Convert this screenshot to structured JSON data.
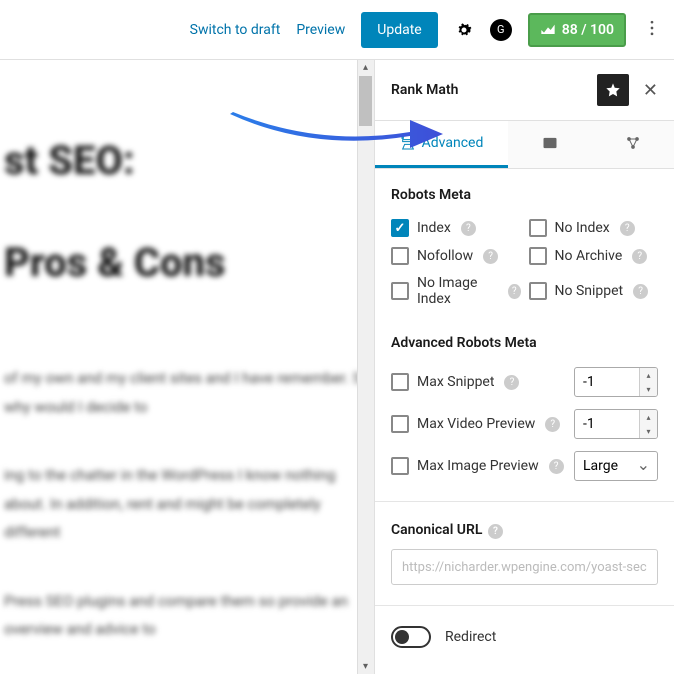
{
  "topbar": {
    "switch_draft": "Switch to draft",
    "preview": "Preview",
    "update": "Update",
    "score": "88 / 100"
  },
  "editor": {
    "title_l1": "st SEO:",
    "title_l2": "Pros & Cons",
    "para1": "of my own and my client sites and I have remember. So, why would I decide to",
    "para2": "ing to the chatter in the WordPress I know nothing about. In addition, rent and might be completely different",
    "para3": "Press SEO plugins and compare them so provide an overview and advice to"
  },
  "sidebar": {
    "title": "Rank Math",
    "tabs": {
      "advanced": "Advanced"
    },
    "robots": {
      "title": "Robots Meta",
      "index": "Index",
      "noindex": "No Index",
      "nofollow": "Nofollow",
      "noarchive": "No Archive",
      "noimage": "No Image Index",
      "nosnippet": "No Snippet"
    },
    "advrobots": {
      "title": "Advanced Robots Meta",
      "maxsnippet": "Max Snippet",
      "maxvideo": "Max Video Preview",
      "maximage": "Max Image Preview",
      "maxsnippet_val": "-1",
      "maxvideo_val": "-1",
      "maximage_val": "Large"
    },
    "canonical": {
      "label": "Canonical URL",
      "placeholder": "https://nicharder.wpengine.com/yoast-sec"
    },
    "redirect": "Redirect"
  }
}
